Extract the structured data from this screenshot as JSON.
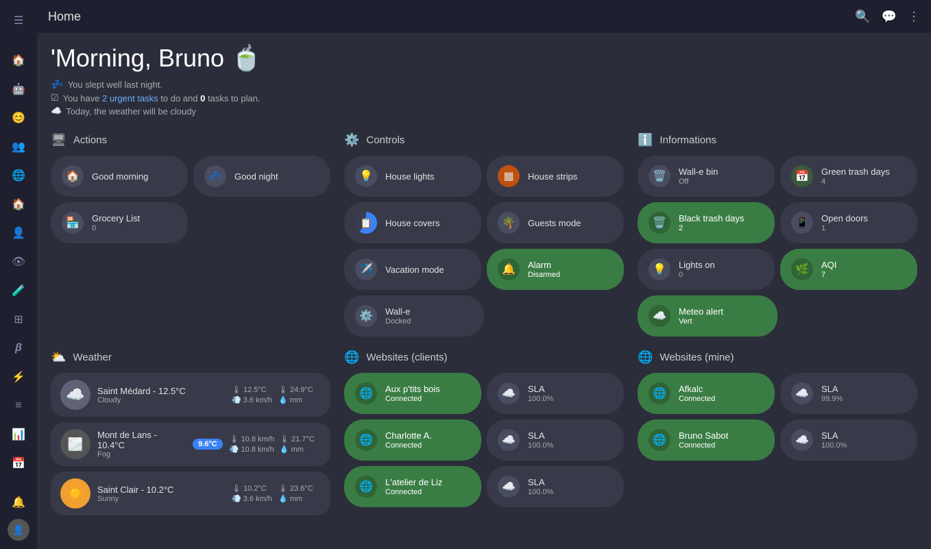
{
  "topbar": {
    "title": "Home"
  },
  "greeting": {
    "title": "'Morning, Bruno 🍵",
    "sleep_line": "You slept well last night.",
    "task_prefix": "You have ",
    "task_link": "2 urgent tasks",
    "task_suffix": " to do and ",
    "task_count": "0",
    "task_end": " tasks to plan.",
    "weather_line": "Today, the weather will be cloudy"
  },
  "sections": {
    "actions": {
      "label": "Actions",
      "items": [
        {
          "id": "good-morning",
          "title": "Good morning",
          "icon": "🏠",
          "sub": "",
          "green": false
        },
        {
          "id": "good-night",
          "title": "Good night",
          "icon": "💤",
          "sub": "",
          "green": false
        },
        {
          "id": "grocery-list",
          "title": "Grocery List",
          "icon": "🏪",
          "sub": "0",
          "green": false
        }
      ]
    },
    "controls": {
      "label": "Controls",
      "items": [
        {
          "id": "house-lights",
          "title": "House lights",
          "icon": "💡",
          "sub": "",
          "green": false
        },
        {
          "id": "house-strips",
          "title": "House strips",
          "icon": "🟧",
          "sub": "",
          "green": false
        },
        {
          "id": "house-covers",
          "title": "House covers",
          "icon": "📋",
          "sub": "",
          "green": false,
          "blue_ring": true
        },
        {
          "id": "guests-mode",
          "title": "Guests mode",
          "icon": "🌴",
          "sub": "",
          "green": false
        },
        {
          "id": "vacation-mode",
          "title": "Vacation mode",
          "icon": "✈️",
          "sub": "",
          "green": false
        },
        {
          "id": "alarm",
          "title": "Alarm",
          "icon": "🔔",
          "sub": "Disarmed",
          "green": true
        },
        {
          "id": "wall-e",
          "title": "Wall-e",
          "icon": "⚙️",
          "sub": "Docked",
          "green": false
        }
      ]
    },
    "informations": {
      "label": "Informations",
      "items": [
        {
          "id": "wall-e-bin",
          "title": "Wall-e bin",
          "icon": "🗑️",
          "sub": "Off",
          "green": false
        },
        {
          "id": "green-trash",
          "title": "Green trash days",
          "icon": "📅",
          "sub": "4",
          "green": false
        },
        {
          "id": "black-trash",
          "title": "Black trash days",
          "icon": "🗑️",
          "sub": "2",
          "green": true
        },
        {
          "id": "open-doors",
          "title": "Open doors",
          "icon": "📱",
          "sub": "1",
          "green": false
        },
        {
          "id": "lights-on",
          "title": "Lights on",
          "icon": "💡",
          "sub": "0",
          "green": false
        },
        {
          "id": "aqi",
          "title": "AQI",
          "icon": "🌿",
          "sub": "7",
          "green": true
        },
        {
          "id": "meteo-alert",
          "title": "Meteo alert",
          "icon": "☁️",
          "sub": "Vert",
          "green": true
        }
      ]
    }
  },
  "weather": {
    "label": "Weather",
    "items": [
      {
        "name": "Saint Médard  - 12.5°C",
        "desc": "Cloudy",
        "icon": "☁️",
        "type": "cloudy",
        "badge": null,
        "temp_low": "12.5°C",
        "temp_high": "24.9°C",
        "wind": "3.6 km/h",
        "rain": "mm"
      },
      {
        "name": "Mont de Lans  - 10.4°C",
        "desc": "Fog",
        "icon": "🌫️",
        "type": "fog",
        "badge": "9.6°C",
        "temp_low": "10.8 km/h",
        "temp_high": "21.7°C",
        "wind": "10.8 km/h",
        "rain": "mm"
      },
      {
        "name": "Saint Clair  - 10.2°C",
        "desc": "Sunny",
        "icon": "☀️",
        "type": "sunny",
        "badge": null,
        "temp_low": "10.2°C",
        "temp_high": "23.6°C",
        "wind": "3.6 km/h",
        "rain": "mm"
      }
    ]
  },
  "websites_clients": {
    "label": "Websites (clients)",
    "items": [
      {
        "name": "Aux p'tits bois",
        "sub": "Connected",
        "green": true,
        "sla": "100.0%",
        "sla_green": false
      },
      {
        "name": "Charlotte A.",
        "sub": "Connected",
        "green": true,
        "sla": "100.0%",
        "sla_green": false
      },
      {
        "name": "L'atelier de Liz",
        "sub": "Connected",
        "green": true,
        "sla": "100.0%",
        "sla_green": false
      }
    ]
  },
  "websites_mine": {
    "label": "Websites (mine)",
    "items": [
      {
        "name": "Afkalc",
        "sub": "Connected",
        "green": true,
        "sla": "99.9%",
        "sla_green": false
      },
      {
        "name": "Bruno Sabot",
        "sub": "Connected",
        "green": true,
        "sla": "100.0%",
        "sla_green": false
      }
    ]
  },
  "sidebar": {
    "items": [
      {
        "icon": "☰",
        "name": "menu"
      },
      {
        "icon": "🏠",
        "name": "home",
        "active": true
      },
      {
        "icon": "🤖",
        "name": "robot"
      },
      {
        "icon": "😊",
        "name": "face"
      },
      {
        "icon": "👥",
        "name": "users"
      },
      {
        "icon": "🌐",
        "name": "globe"
      },
      {
        "icon": "🏠",
        "name": "house"
      },
      {
        "icon": "👤",
        "name": "person"
      },
      {
        "icon": "👁",
        "name": "eye"
      },
      {
        "icon": "🧪",
        "name": "test"
      },
      {
        "icon": "⊞",
        "name": "grid"
      },
      {
        "icon": "β",
        "name": "beta"
      },
      {
        "icon": "⚡",
        "name": "power"
      },
      {
        "icon": "☰",
        "name": "list"
      },
      {
        "icon": "📊",
        "name": "chart"
      },
      {
        "icon": "📅",
        "name": "calendar"
      },
      {
        "icon": "🔔",
        "name": "bell"
      }
    ]
  }
}
